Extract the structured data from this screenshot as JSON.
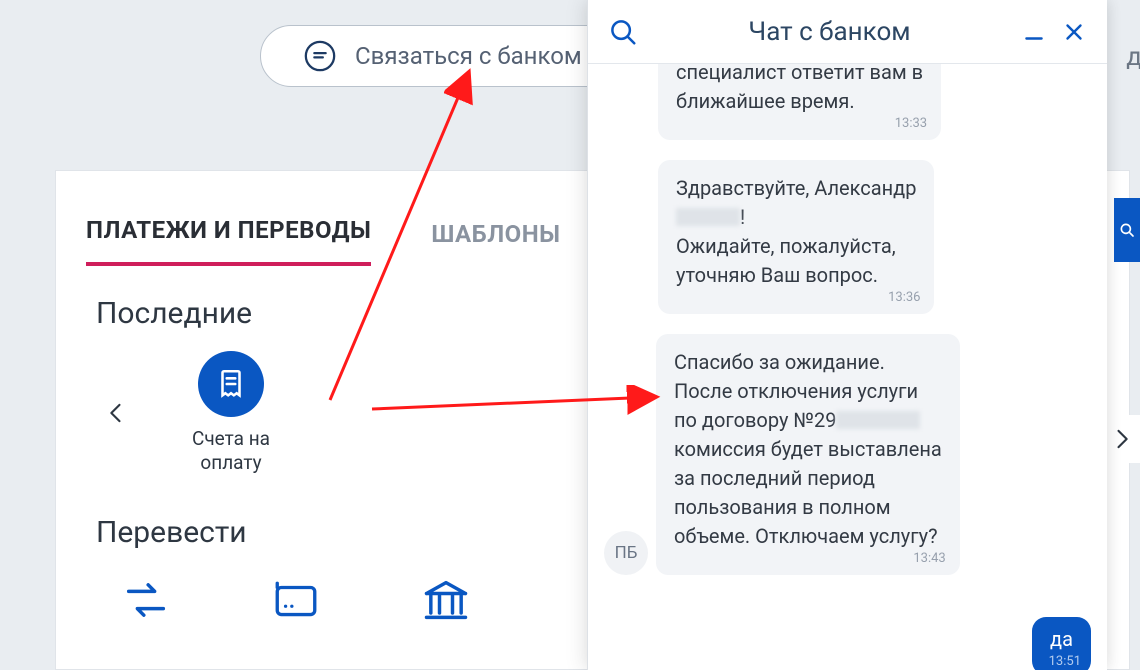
{
  "contact": {
    "label": "Связаться с банком"
  },
  "tabs": {
    "payments": "ПЛАТЕЖИ И ПЕРЕВОДЫ",
    "templates": "ШАБЛОНЫ"
  },
  "recent": {
    "title": "Последние",
    "items": [
      {
        "label": "Счета на оплату",
        "icon": "receipt-icon"
      }
    ]
  },
  "transfer": {
    "title": "Перевести"
  },
  "chat": {
    "title": "Чат с банком",
    "avatar_initials": "ПБ",
    "messages": [
      {
        "kind": "in",
        "text_line1": "специалист ответит вам в",
        "text_line2": "ближайшее время.",
        "time": "13:33",
        "cut_top": true
      },
      {
        "kind": "in",
        "text_line1": "Здравствуйте, Александр",
        "text_line2": "!",
        "text_line3": "Ожидайте, пожалуйста,",
        "text_line4": "уточняю Ваш вопрос.",
        "time": "13:36",
        "has_censor_after_line1": true
      },
      {
        "kind": "in",
        "text_line1": "Спасибо за ожидание.",
        "text_line2": "После отключения услуги",
        "text_line3": "по договору №29",
        "text_line4": "комиссия будет выставлена",
        "text_line5": "за последний период",
        "text_line6": "пользования в полном",
        "text_line7": "объеме. Отключаем услугу?",
        "time": "13:43",
        "has_censor_after_line3": true,
        "show_avatar": true
      },
      {
        "kind": "out",
        "text": "да",
        "time": "13:51"
      }
    ]
  },
  "sliver": {
    "letter": "д"
  }
}
